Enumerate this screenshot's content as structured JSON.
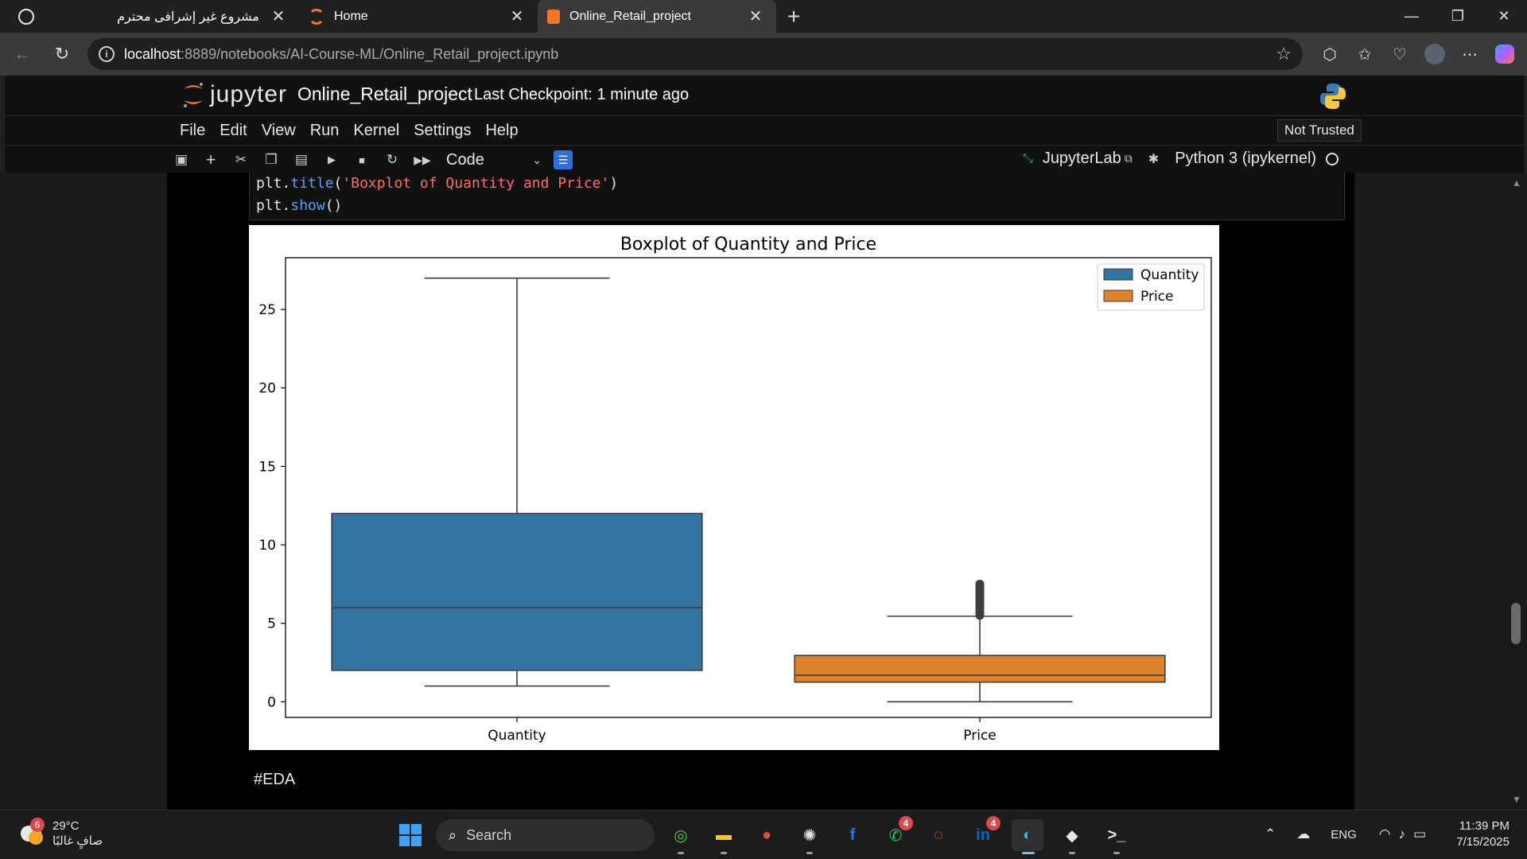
{
  "browser": {
    "tabs": [
      {
        "label": "مشروع غير إشرافى محترم",
        "close": "✕"
      },
      {
        "label": "Home",
        "close": "✕"
      },
      {
        "label": "Online_Retail_project",
        "close": "✕"
      }
    ],
    "new_tab": "+",
    "window_controls": {
      "minimize": "—",
      "restore": "❐",
      "close": "✕"
    },
    "url_host": "localhost",
    "url_path": ":8889/notebooks/AI-Course-ML/Online_Retail_project.ipynb",
    "icons": [
      "back-icon",
      "refresh-icon",
      "info-icon",
      "star-icon",
      "extensions-icon",
      "favorites-icon",
      "health-icon",
      "profile-avatar",
      "more-icon",
      "copilot-icon"
    ]
  },
  "jupyter": {
    "logo_text": "jupyter",
    "notebook_name": "Online_Retail_project",
    "checkpoint": "Last Checkpoint: 1 minute ago",
    "menu": [
      "File",
      "Edit",
      "View",
      "Run",
      "Kernel",
      "Settings",
      "Help"
    ],
    "trust": "Not Trusted",
    "cell_type": "Code",
    "jupyterlab_link": "JupyterLab",
    "kernel_name": "Python 3 (ipykernel)",
    "code_lines": [
      {
        "obj": "plt.",
        "fn": "title",
        "open": "(",
        "str": "'Boxplot of Quantity and Price'",
        "close": ")"
      },
      {
        "obj": "plt.",
        "fn": "show",
        "open": "()",
        "str": "",
        "close": ""
      }
    ],
    "markdown_cell": "#EDA"
  },
  "chart_data": {
    "type": "boxplot",
    "title": "Boxplot of Quantity and Price",
    "categories": [
      "Quantity",
      "Price"
    ],
    "ylim": [
      -1,
      28.3
    ],
    "yticks": [
      0,
      5,
      10,
      15,
      20,
      25
    ],
    "legend": {
      "placement": "top-right",
      "entries": [
        "Quantity",
        "Price"
      ]
    },
    "colors": {
      "Quantity": "#3274a1",
      "Price": "#e1812c"
    },
    "series": [
      {
        "name": "Quantity",
        "whisker_low": 1,
        "q1": 2,
        "median": 6,
        "q3": 12,
        "whisker_high": 27,
        "outliers": []
      },
      {
        "name": "Price",
        "whisker_low": 0,
        "q1": 1.25,
        "median": 1.69,
        "q3": 2.95,
        "whisker_high": 5.45,
        "outliers": [
          5.5,
          5.6,
          5.75,
          5.9,
          6.0,
          6.15,
          6.3,
          6.45,
          6.6,
          6.75,
          6.9,
          7.05,
          7.2,
          7.35,
          7.5
        ]
      }
    ],
    "grid": false
  },
  "taskbar": {
    "weather": {
      "temp": "29°C",
      "desc": "صافٍ غالبًا",
      "badge": "6"
    },
    "search_label": "Search",
    "apps": [
      {
        "name": "maps-app-icon",
        "glyph": "◎",
        "color": "#57c443"
      },
      {
        "name": "file-explorer-icon",
        "glyph": "▬",
        "color": "#f4c430"
      },
      {
        "name": "chrome-icon",
        "glyph": "●",
        "color": "#e8453c"
      },
      {
        "name": "chatgpt-icon",
        "glyph": "✺",
        "color": "#e6e6e6"
      },
      {
        "name": "facebook-icon",
        "glyph": "f",
        "color": "#1877f2"
      },
      {
        "name": "whatsapp-icon",
        "glyph": "✆",
        "color": "#25d366",
        "badge": "4"
      },
      {
        "name": "jupyter-app-icon",
        "glyph": "◌",
        "color": "#f37726"
      },
      {
        "name": "linkedin-icon",
        "glyph": "in",
        "color": "#0a66c2",
        "badge": "4"
      },
      {
        "name": "edge-icon",
        "glyph": "◐",
        "color": "#29b6f6"
      },
      {
        "name": "ghost-app-icon",
        "glyph": "◆",
        "color": "#e6e6e6"
      },
      {
        "name": "terminal-icon",
        "glyph": ">_",
        "color": "#e6e6e6"
      }
    ],
    "tray_lang": "ENG",
    "time": "11:39 PM",
    "date": "7/15/2025"
  }
}
